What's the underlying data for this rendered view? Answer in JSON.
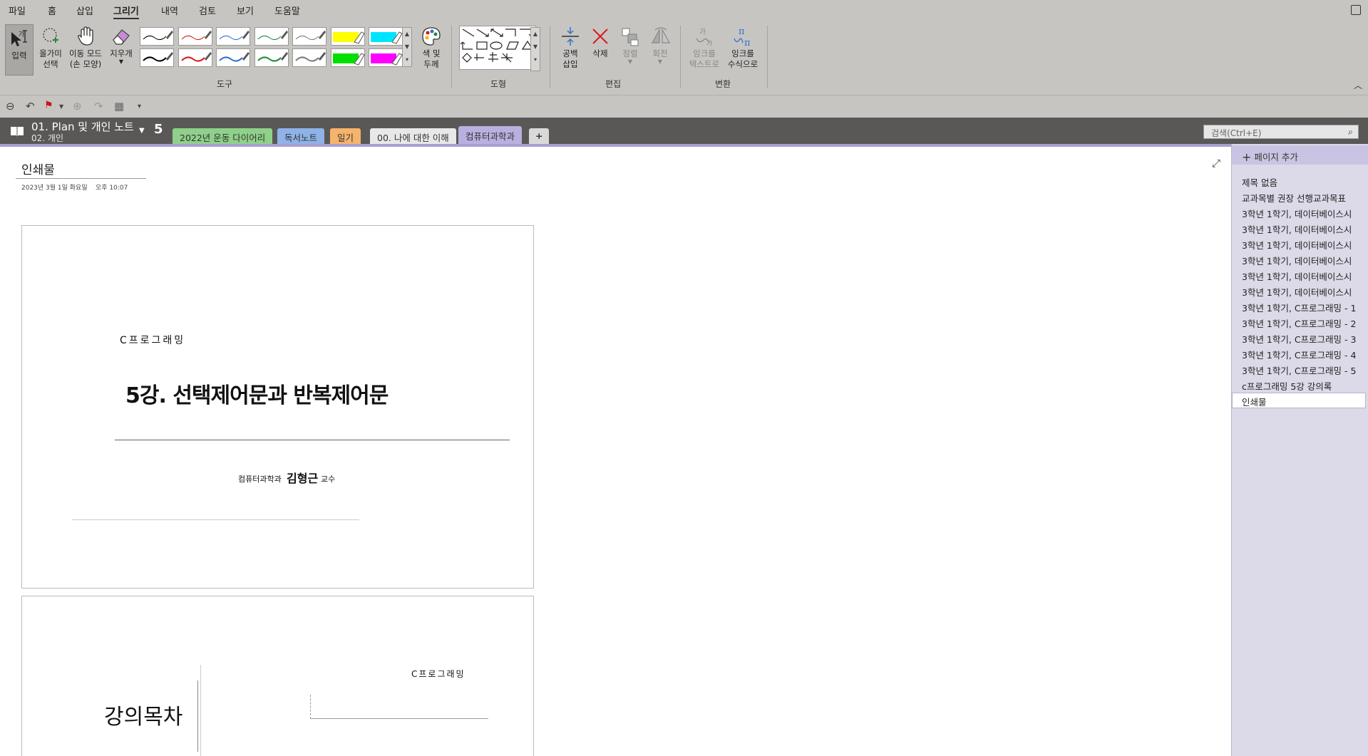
{
  "menu": [
    "파일",
    "홈",
    "삽입",
    "그리기",
    "내역",
    "검토",
    "보기",
    "도움말"
  ],
  "active_menu": "그리기",
  "toolbar": {
    "input": "입력",
    "lasso": "올가미\n선택",
    "pan": "이동 모드\n(손 모양)",
    "eraser": "지우개",
    "color_thickness": "색 및\n두께",
    "insert_space": "공백\n삽입",
    "delete": "삭제",
    "arrange": "정렬",
    "rotate": "회전",
    "ink_to_text": "잉크를\n텍스트로",
    "ink_to_math": "잉크를\n수식으로",
    "group_tools": "도구",
    "group_shapes": "도형",
    "group_edit": "편집",
    "group_convert": "변환",
    "pen_colors_top": [
      "#000000",
      "#d81b1b",
      "#2f6fd0",
      "#1e8a3a",
      "#7a7a7a",
      "#ffff00",
      "#00e5ff"
    ],
    "pen_colors_bottom": [
      "#000000",
      "#d81b1b",
      "#2f6fd0",
      "#1e8a3a",
      "#7a7a7a",
      "#00e000",
      "#ff00ff"
    ]
  },
  "notebook": {
    "title": "01. Plan 및 개인 노트",
    "section_group": "02. 개인",
    "badge": "5"
  },
  "sections": [
    {
      "label": "2022년 운동 다이어리",
      "color": "#8fd18a"
    },
    {
      "label": "독서노트",
      "color": "#8fb3e8"
    },
    {
      "label": "일기",
      "color": "#f5b36b"
    },
    {
      "label": "00. 나에 대한 이해",
      "color": "#e8e8e8"
    },
    {
      "label": "컴퓨터과학과",
      "color": "#b9b0e0"
    }
  ],
  "add_section": "+",
  "search": {
    "placeholder": "검색(Ctrl+E)"
  },
  "page": {
    "title": "인쇄물",
    "date": "2023년 3월 1일 화요일",
    "time": "오후 10:07"
  },
  "slide1": {
    "label": "C프로그래밍",
    "title": "5강. 선택제어문과 반복제어문",
    "dept": "컴퓨터과학과",
    "professor": "김형근",
    "suffix": "교수"
  },
  "slide2": {
    "label": "C프로그래밍",
    "title": "강의목차"
  },
  "page_panel": {
    "add_page": "페이지 추가",
    "pages": [
      "제목 없음",
      "교과목별 권장 선행교과목표",
      "3학년 1학기, 데이터베이스시",
      "3학년 1학기, 데이터베이스시",
      "3학년 1학기, 데이터베이스시",
      "3학년 1학기, 데이터베이스시",
      "3학년 1학기, 데이터베이스시",
      "3학년 1학기, 데이터베이스시",
      "3학년 1학기, C프로그래밍 - 1",
      "3학년 1학기, C프로그래밍 - 2",
      "3학년 1학기, C프로그래밍 - 3",
      "3학년 1학기, C프로그래밍 - 4",
      "3학년 1학기, C프로그래밍 - 5",
      "c프로그래밍 5강 강의록"
    ],
    "current_page": "인쇄물"
  }
}
